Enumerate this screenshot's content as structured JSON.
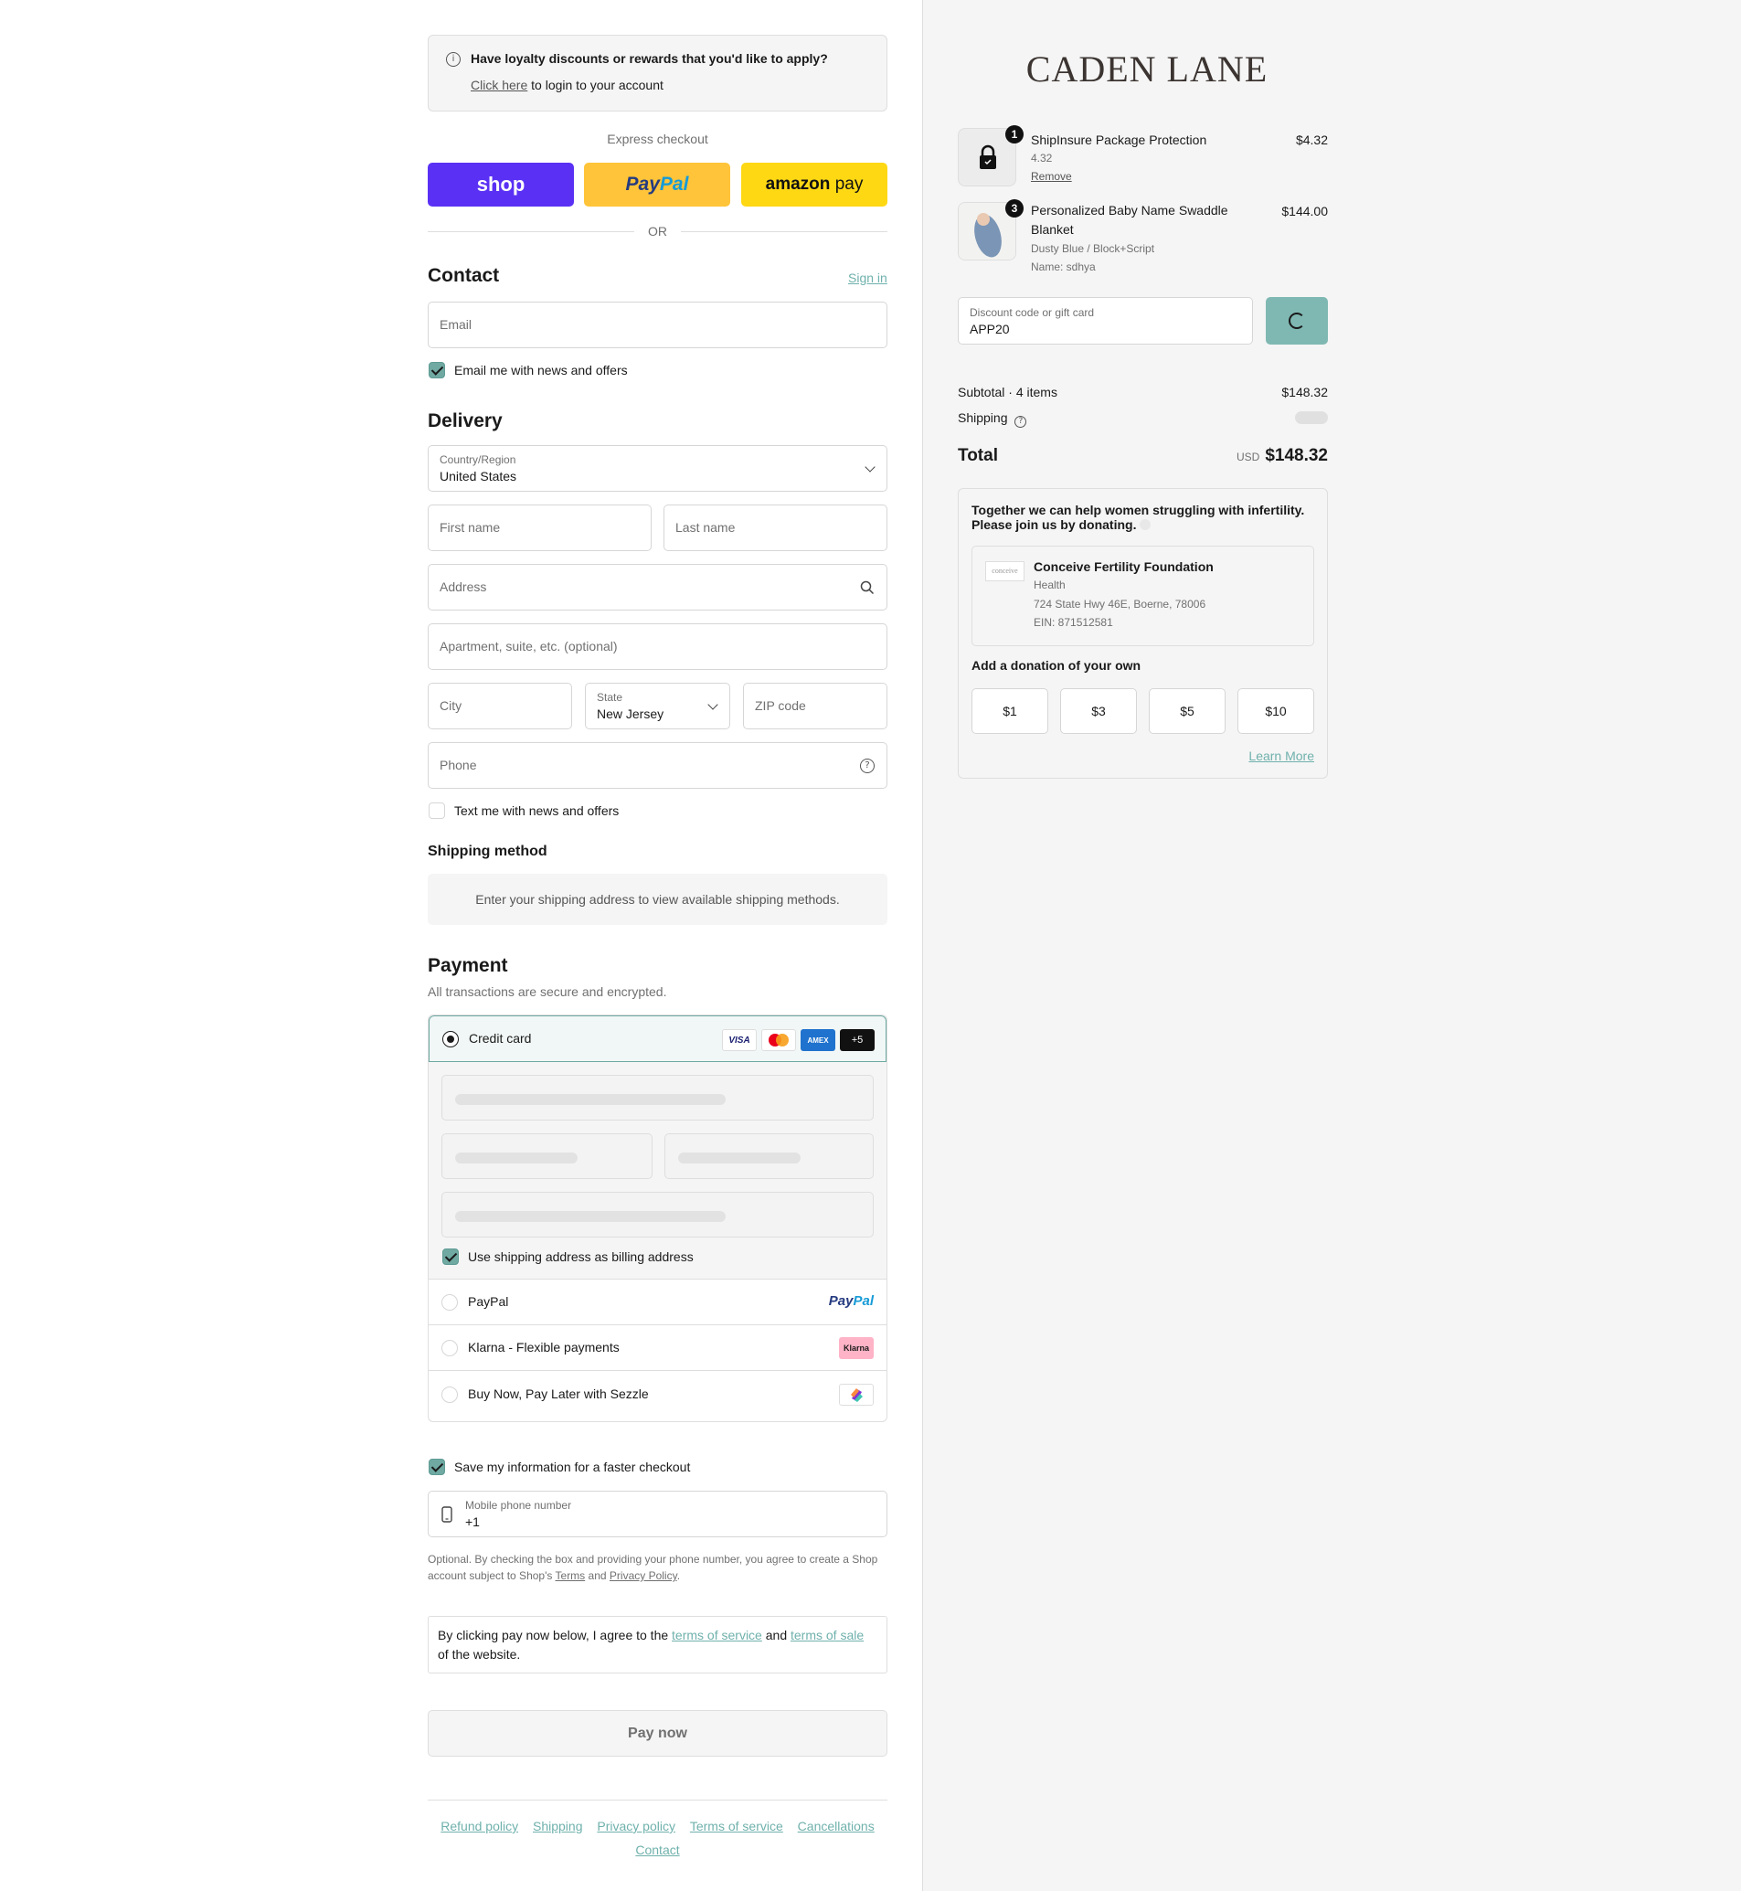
{
  "loyalty": {
    "title": "Have loyalty discounts or rewards that you'd like to apply?",
    "link": "Click here",
    "suffix": "to login to your account"
  },
  "express": {
    "label": "Express checkout",
    "shop": "shop",
    "paypal_a": "Pay",
    "paypal_b": "Pal",
    "amazon_a": "amazon",
    "amazon_b": "pay",
    "or": "OR"
  },
  "contact": {
    "title": "Contact",
    "signin": "Sign in",
    "email_placeholder": "Email",
    "news_label": "Email me with news and offers",
    "news_checked": true
  },
  "delivery": {
    "title": "Delivery",
    "country_label": "Country/Region",
    "country_value": "United States",
    "first_name": "First name",
    "last_name": "Last name",
    "address": "Address",
    "apartment": "Apartment, suite, etc. (optional)",
    "city": "City",
    "state_label": "State",
    "state_value": "New Jersey",
    "zip": "ZIP code",
    "phone": "Phone",
    "text_label": "Text me with news and offers",
    "text_checked": false
  },
  "shipping_method": {
    "title": "Shipping method",
    "message": "Enter your shipping address to view available shipping methods."
  },
  "payment": {
    "title": "Payment",
    "subtitle": "All transactions are secure and encrypted.",
    "credit_card": "Credit card",
    "card_logos": [
      "VISA",
      "mastercard",
      "AMEX",
      "+5"
    ],
    "billing_label": "Use shipping address as billing address",
    "paypal": "PayPal",
    "paypal_logo_a": "Pay",
    "paypal_logo_b": "Pal",
    "klarna": "Klarna - Flexible payments",
    "klarna_logo": "Klarna",
    "sezzle": "Buy Now, Pay Later with Sezzle"
  },
  "save_info": {
    "label": "Save my information for a faster checkout",
    "checked": true,
    "phone_label": "Mobile phone number",
    "phone_value": "+1",
    "note_a": "Optional. By checking the box and providing your phone number, you agree to create a Shop account subject to Shop's",
    "terms": "Terms",
    "and": "and",
    "privacy": "Privacy Policy",
    "period": "."
  },
  "agreement": {
    "a": "By clicking pay now below, I agree to the",
    "tos": "terms of service",
    "and": "and",
    "tosale": "terms of sale",
    "b": "of the website."
  },
  "pay_now": "Pay now",
  "footer": [
    "Refund policy",
    "Shipping",
    "Privacy policy",
    "Terms of service",
    "Cancellations",
    "Contact"
  ],
  "brand": "CADEN LANE",
  "cart": {
    "items": [
      {
        "qty": "1",
        "name": "ShipInsure Package Protection",
        "sub": "4.32",
        "action": "Remove",
        "price": "$4.32"
      },
      {
        "qty": "3",
        "name_a": "Personalized Baby Name Swaddle",
        "name_b": "Blanket",
        "sub": "Dusty Blue / Block+Script",
        "sub2": "Name: sdhya",
        "price": "$144.00"
      }
    ],
    "discount_label": "Discount code or gift card",
    "discount_value": "APP20",
    "subtotal_label": "Subtotal · 4 items",
    "subtotal_value": "$148.32",
    "shipping_label": "Shipping",
    "total_label": "Total",
    "currency": "USD",
    "total_value": "$148.32"
  },
  "donation": {
    "heading_a": "Together we can help women struggling with infertility.",
    "heading_b": "Please join us by donating.",
    "org_logo": "conceive",
    "org_name": "Conceive Fertility Foundation",
    "org_category": "Health",
    "org_address": "724 State Hwy 46E, Boerne, 78006",
    "org_ein": "EIN: 871512581",
    "own_label": "Add a donation of your own",
    "amounts": [
      "$1",
      "$3",
      "$5",
      "$10"
    ],
    "learn_more": "Learn More"
  },
  "colors": {
    "accent": "#6fa9a2",
    "shop": "#5a31f4",
    "paypal": "#ffc439",
    "amazon": "#ffd814"
  }
}
